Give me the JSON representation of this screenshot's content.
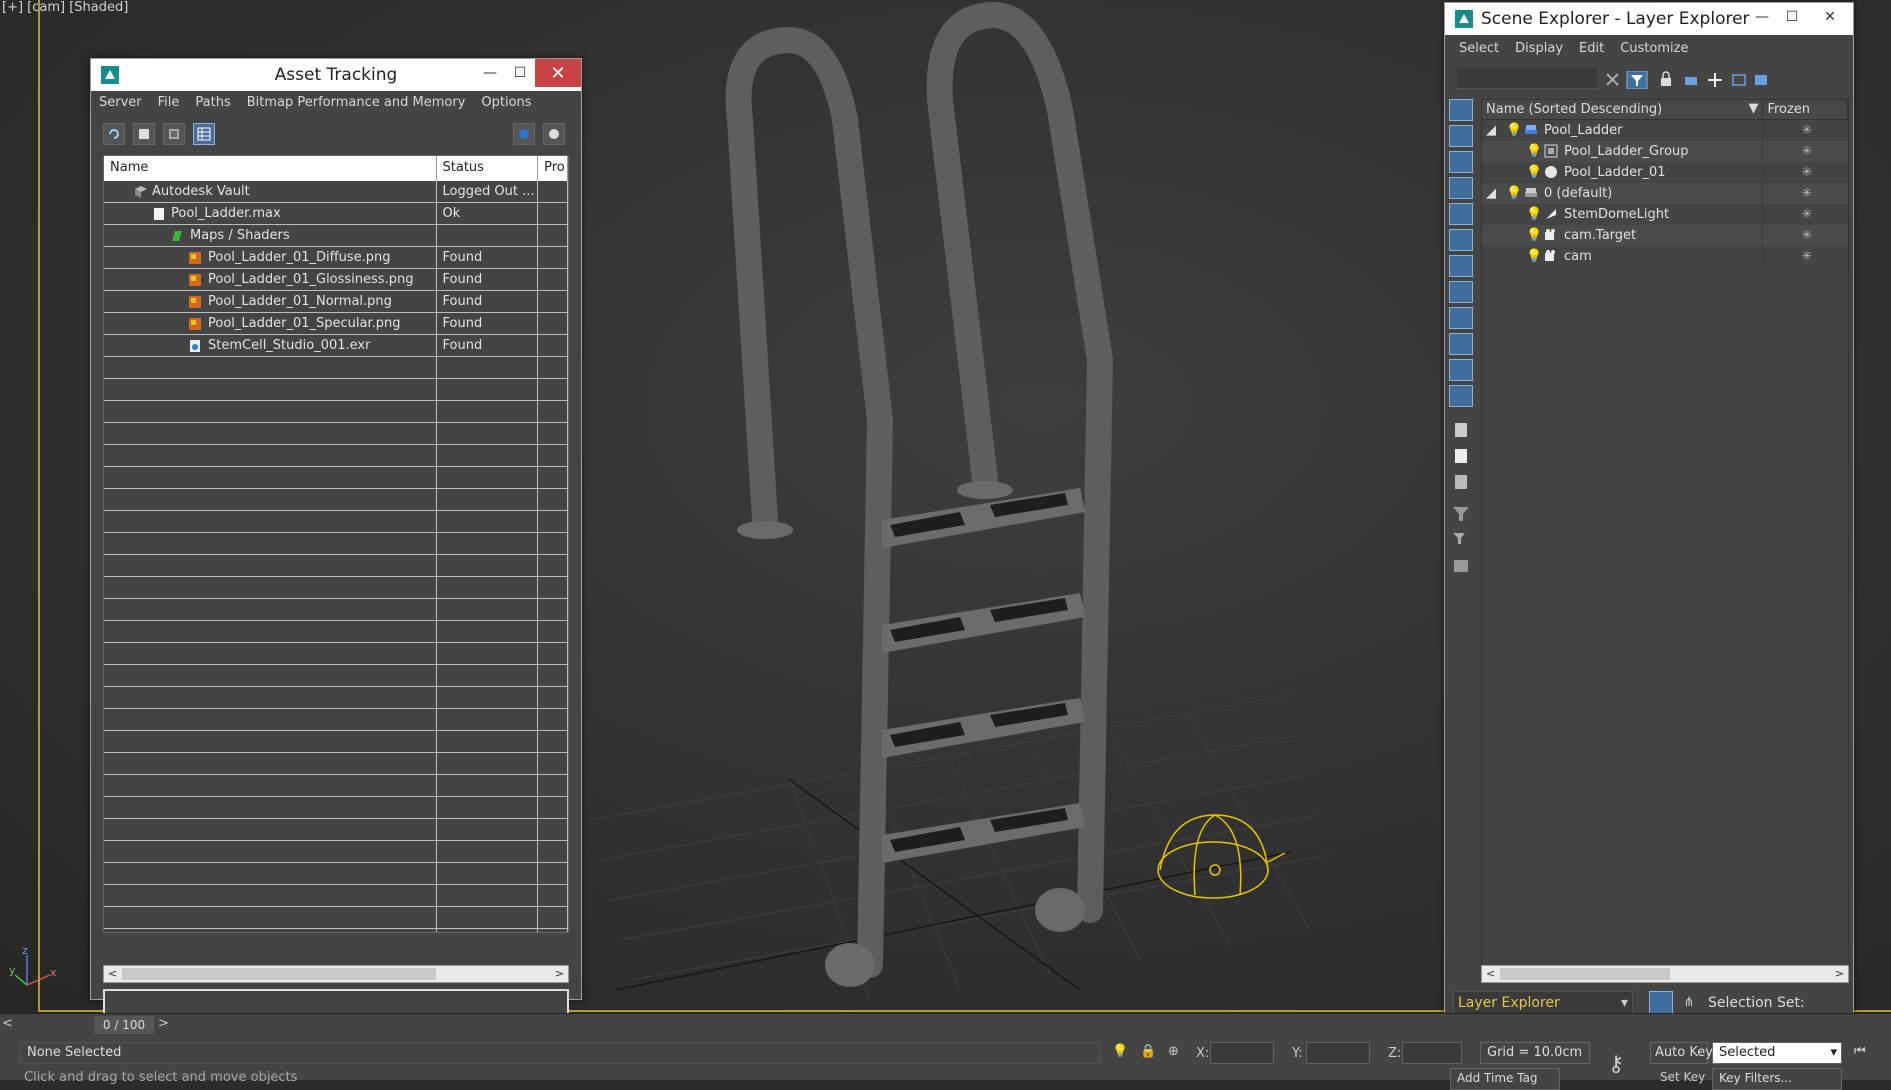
{
  "viewport": {
    "label": "[+] [cam] [Shaded]",
    "axis_labels": {
      "z": "z",
      "y": "y",
      "x": "x"
    },
    "colors": {
      "border": "#b49a2a",
      "light_gizmo": "#e8c400",
      "mesh": "#6d6d6d"
    }
  },
  "asset_tracking": {
    "title": "Asset Tracking",
    "menu": [
      "Server",
      "File",
      "Paths",
      "Bitmap Performance and Memory",
      "Options"
    ],
    "columns": [
      "Name",
      "Status",
      "Pro"
    ],
    "rows": [
      {
        "name": "Autodesk Vault",
        "status": "Logged Out ...",
        "icon": "vault-icon"
      },
      {
        "name": "Pool_Ladder.max",
        "status": "Ok",
        "icon": "file-icon"
      },
      {
        "name": "Maps / Shaders",
        "status": "",
        "icon": "maps-icon"
      },
      {
        "name": "Pool_Ladder_01_Diffuse.png",
        "status": "Found",
        "icon": "bitmap-icon"
      },
      {
        "name": "Pool_Ladder_01_Glossiness.png",
        "status": "Found",
        "icon": "bitmap-icon"
      },
      {
        "name": "Pool_Ladder_01_Normal.png",
        "status": "Found",
        "icon": "bitmap-icon"
      },
      {
        "name": "Pool_Ladder_01_Specular.png",
        "status": "Found",
        "icon": "bitmap-icon"
      },
      {
        "name": "StemCell_Studio_001.exr",
        "status": "Found",
        "icon": "hdri-icon"
      }
    ]
  },
  "scene_explorer": {
    "title": "Scene Explorer - Layer Explorer",
    "menu": [
      "Select",
      "Display",
      "Edit",
      "Customize"
    ],
    "columns": [
      "Name (Sorted Descending)",
      "Frozen"
    ],
    "rows": [
      {
        "name": "Pool_Ladder",
        "icon": "layer-icon"
      },
      {
        "name": "Pool_Ladder_Group",
        "icon": "group-icon"
      },
      {
        "name": "Pool_Ladder_01",
        "icon": "geometry-icon"
      },
      {
        "name": "0 (default)",
        "icon": "layer-icon"
      },
      {
        "name": "StemDomeLight",
        "icon": "light-icon"
      },
      {
        "name": "cam.Target",
        "icon": "camera-icon"
      },
      {
        "name": "cam",
        "icon": "camera-icon"
      }
    ],
    "explorer_type": "Layer Explorer",
    "selection_set_label": "Selection Set:",
    "accent": "#e8c84a"
  },
  "status_bar": {
    "time": "0 / 100",
    "selection": "None Selected",
    "hint": "Click and drag to select and move objects",
    "x_label": "X:",
    "y_label": "Y:",
    "z_label": "Z:",
    "grid": "Grid = 10.0cm",
    "auto_key": "Auto Key",
    "key_mode": "Selected",
    "set_key": "Set Key",
    "key_filters": "Key Filters...",
    "add_time_tag": "Add Time Tag"
  }
}
